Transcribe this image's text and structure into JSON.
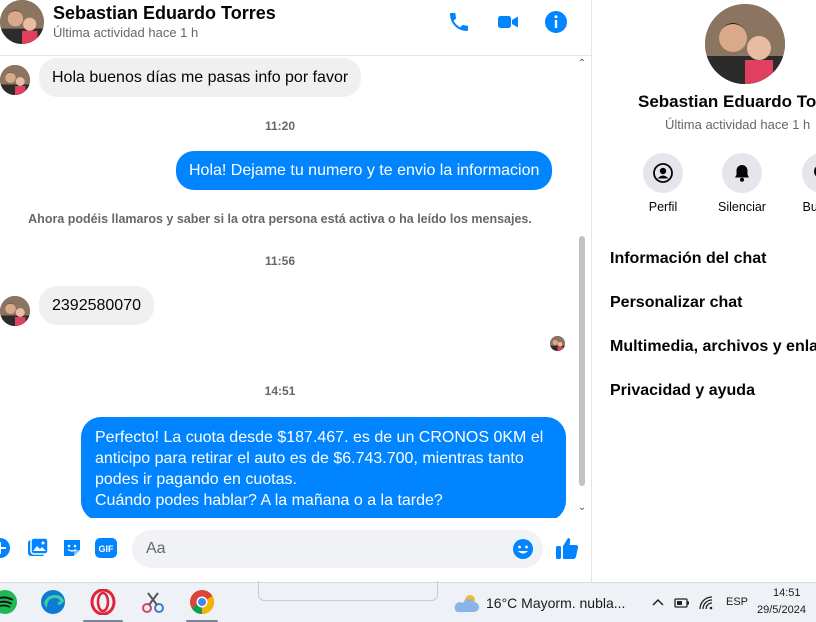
{
  "header": {
    "name": "Sebastian Eduardo Torres",
    "status": "Última actividad hace 1 h",
    "icons": [
      "phone-icon",
      "video-icon",
      "info-icon"
    ]
  },
  "messages": {
    "items": [
      {
        "direction": "in",
        "text": "Hola buenos días me pasas info por favor"
      },
      {
        "type": "time",
        "text": "11:20"
      },
      {
        "direction": "out",
        "text": "Hola! Dejame tu numero y te envio la informacion"
      },
      {
        "type": "system",
        "text": "Ahora podéis llamaros y saber si la otra persona está activa o ha leído los mensajes."
      },
      {
        "type": "time",
        "text": "11:56"
      },
      {
        "direction": "in",
        "text": "2392580070"
      },
      {
        "type": "time",
        "text": "14:51"
      },
      {
        "direction": "out",
        "lines": [
          "Perfecto! La cuota desde $187.467. es de un CRONOS 0KM el",
          "anticipo para retirar el auto es de $6.743.700, mientras tanto",
          "podes ir pagando en cuotas.",
          "Cuándo podes hablar? A la mañana o a la tarde?"
        ]
      }
    ]
  },
  "composer": {
    "placeholder": "Aa",
    "icons": [
      "add-icon",
      "image-icon",
      "sticker-icon",
      "gif-icon",
      "emoji-icon",
      "thumbs-up-icon"
    ],
    "gif_label": "GIF"
  },
  "info_panel": {
    "name": "Sebastian Eduardo Torres",
    "status": "Última actividad hace 1 h",
    "actions": [
      {
        "label": "Perfil",
        "icon": "profile-icon"
      },
      {
        "label": "Silenciar",
        "icon": "bell-icon"
      },
      {
        "label": "Buscar",
        "icon": "search-icon"
      }
    ],
    "menu": [
      "Información del chat",
      "Personalizar chat",
      "Multimedia, archivos y enlaces",
      "Privacidad y ayuda"
    ]
  },
  "taskbar": {
    "apps": [
      "spotify-icon",
      "edge-icon",
      "opera-icon",
      "snipping-tool-icon",
      "chrome-icon"
    ],
    "weather": "16°C  Mayorm. nubla...",
    "language": "ESP",
    "time": "14:51",
    "date": "29/5/2024"
  },
  "colors": {
    "accent": "#0084ff",
    "incoming_bubble": "#f0f0f0",
    "secondary_text": "#65676b"
  }
}
